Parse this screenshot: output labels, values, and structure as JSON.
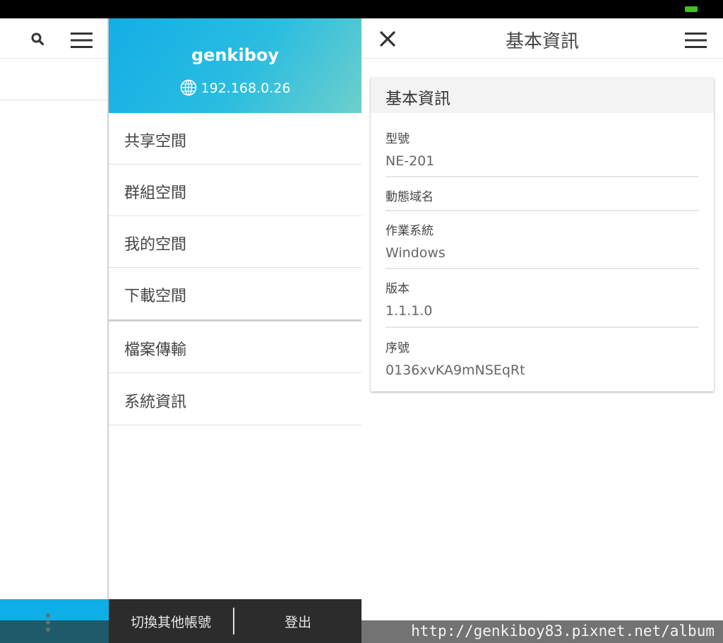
{
  "drawer": {
    "username": "genkiboy",
    "ip": "192.168.0.26",
    "menu": [
      {
        "label": "共享空間"
      },
      {
        "label": "群組空間"
      },
      {
        "label": "我的空間"
      },
      {
        "label": "下載空間"
      },
      {
        "label": "檔案傳輸"
      },
      {
        "label": "系統資訊"
      }
    ],
    "footer": {
      "switch_account": "切換其他帳號",
      "logout": "登出"
    }
  },
  "page": {
    "title": "基本資訊",
    "card_title": "基本資訊",
    "fields": [
      {
        "label": "型號",
        "value": "NE-201"
      },
      {
        "label": "動態域名",
        "value": ""
      },
      {
        "label": "作業系統",
        "value": "Windows"
      },
      {
        "label": "版本",
        "value": "1.1.1.0"
      },
      {
        "label": "序號",
        "value": "0136xvKA9mNSEqRt"
      }
    ]
  },
  "watermark": "http://genkiboy83.pixnet.net/album",
  "colors": {
    "header_gradient_start": "#12aee6",
    "header_gradient_end": "#6ecfcc",
    "battery": "#3fc41d"
  }
}
